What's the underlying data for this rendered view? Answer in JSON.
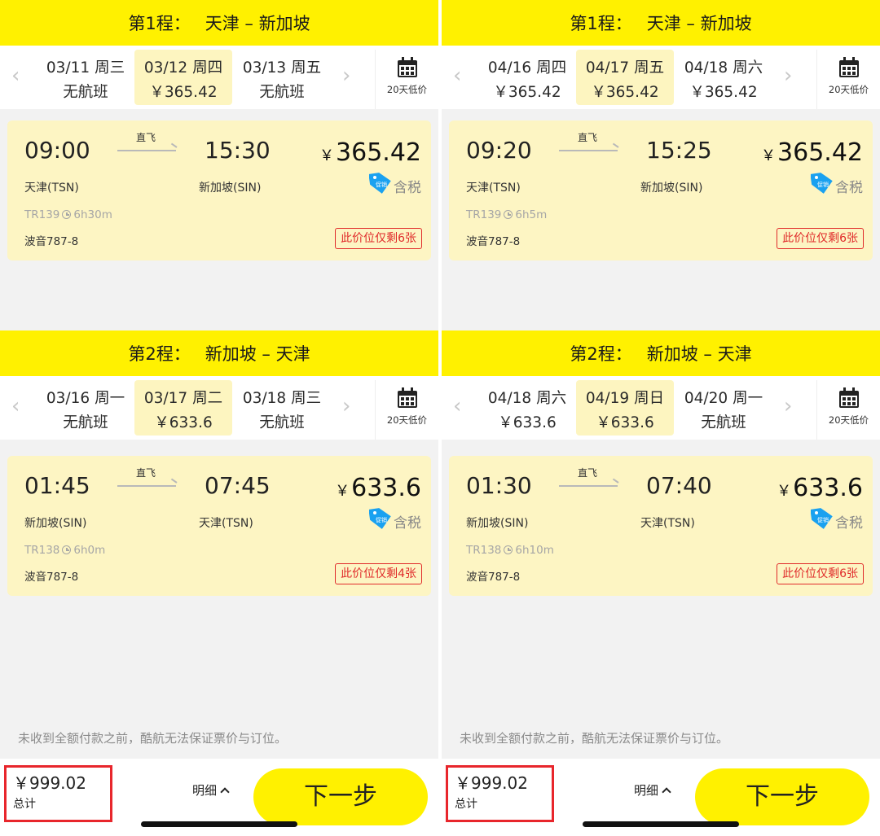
{
  "panels": [
    {
      "legs": [
        {
          "header": {
            "seq": "第1程：",
            "route": "天津 – 新加坡"
          },
          "nav": {
            "prev": "‹",
            "next": "›"
          },
          "dates": [
            {
              "date": "03/11 周三",
              "price": "无航班",
              "selected": false
            },
            {
              "date": "03/12 周四",
              "price": "￥365.42",
              "selected": true
            },
            {
              "date": "03/13 周五",
              "price": "无航班",
              "selected": false
            }
          ],
          "calendar_label": "20天低价",
          "flight": {
            "dep_time": "09:00",
            "arr_time": "15:30",
            "direct": "直飞",
            "dep_airport": "天津(TSN)",
            "arr_airport": "新加坡(SIN)",
            "flight_no": "TR139",
            "duration": "6h30m",
            "aircraft": "波音787-8",
            "currency": "￥",
            "price": "365.42",
            "promo": "促销",
            "tax": "含税",
            "seats": "此价位仅剩6张"
          }
        },
        {
          "header": {
            "seq": "第2程：",
            "route": "新加坡 – 天津"
          },
          "nav": {
            "prev": "‹",
            "next": "›"
          },
          "dates": [
            {
              "date": "03/16 周一",
              "price": "无航班",
              "selected": false
            },
            {
              "date": "03/17 周二",
              "price": "￥633.6",
              "selected": true
            },
            {
              "date": "03/18 周三",
              "price": "无航班",
              "selected": false
            }
          ],
          "calendar_label": "20天低价",
          "flight": {
            "dep_time": "01:45",
            "arr_time": "07:45",
            "direct": "直飞",
            "dep_airport": "新加坡(SIN)",
            "arr_airport": "天津(TSN)",
            "flight_no": "TR138",
            "duration": "6h0m",
            "aircraft": "波音787-8",
            "currency": "￥",
            "price": "633.6",
            "promo": "促销",
            "tax": "含税",
            "seats": "此价位仅剩4张"
          }
        }
      ],
      "disclaimer": "未收到全额付款之前，酷航无法保证票价与订位。",
      "footer": {
        "total": "￥999.02",
        "total_label": "总计",
        "detail": "明细",
        "next": "下一步"
      }
    },
    {
      "legs": [
        {
          "header": {
            "seq": "第1程：",
            "route": "天津 – 新加坡"
          },
          "nav": {
            "prev": "‹",
            "next": "›"
          },
          "dates": [
            {
              "date": "04/16 周四",
              "price": "￥365.42",
              "selected": false
            },
            {
              "date": "04/17 周五",
              "price": "￥365.42",
              "selected": true
            },
            {
              "date": "04/18 周六",
              "price": "￥365.42",
              "selected": false
            }
          ],
          "calendar_label": "20天低价",
          "flight": {
            "dep_time": "09:20",
            "arr_time": "15:25",
            "direct": "直飞",
            "dep_airport": "天津(TSN)",
            "arr_airport": "新加坡(SIN)",
            "flight_no": "TR139",
            "duration": "6h5m",
            "aircraft": "波音787-8",
            "currency": "￥",
            "price": "365.42",
            "promo": "促销",
            "tax": "含税",
            "seats": "此价位仅剩6张"
          }
        },
        {
          "header": {
            "seq": "第2程：",
            "route": "新加坡 – 天津"
          },
          "nav": {
            "prev": "‹",
            "next": "›"
          },
          "dates": [
            {
              "date": "04/18 周六",
              "price": "￥633.6",
              "selected": false
            },
            {
              "date": "04/19 周日",
              "price": "￥633.6",
              "selected": true
            },
            {
              "date": "04/20 周一",
              "price": "无航班",
              "selected": false
            }
          ],
          "calendar_label": "20天低价",
          "flight": {
            "dep_time": "01:30",
            "arr_time": "07:40",
            "direct": "直飞",
            "dep_airport": "新加坡(SIN)",
            "arr_airport": "天津(TSN)",
            "flight_no": "TR138",
            "duration": "6h10m",
            "aircraft": "波音787-8",
            "currency": "￥",
            "price": "633.6",
            "promo": "促销",
            "tax": "含税",
            "seats": "此价位仅剩6张"
          }
        }
      ],
      "disclaimer": "未收到全额付款之前，酷航无法保证票价与订位。",
      "footer": {
        "total": "￥999.02",
        "total_label": "总计",
        "detail": "明细",
        "next": "下一步"
      }
    }
  ],
  "icons": {
    "calendar": "calendar-icon",
    "clock": "clock-icon",
    "promo": "promo-tag-icon",
    "chevron": "chevron-up-icon"
  },
  "colors": {
    "brand_yellow": "#fff100",
    "card_bg": "#fdf5c3",
    "alert_red": "#e02a2a",
    "highlight_red": "#e8262c",
    "promo_blue": "#1aa1f0"
  }
}
